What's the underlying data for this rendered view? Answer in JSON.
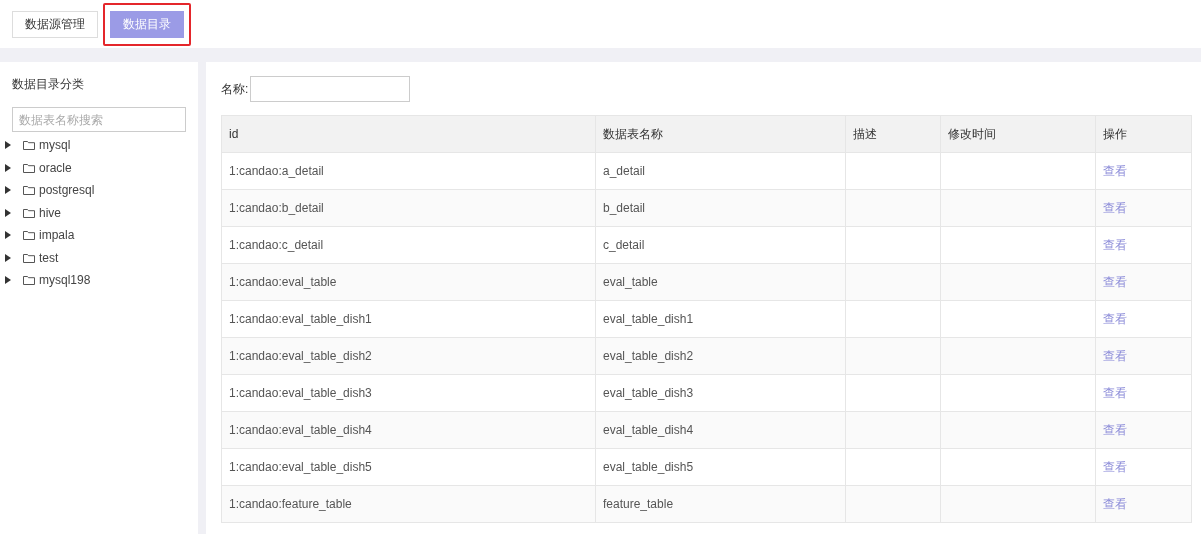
{
  "tabs": [
    {
      "label": "数据源管理",
      "selected": false,
      "highlighted": false
    },
    {
      "label": "数据目录",
      "selected": true,
      "highlighted": true
    }
  ],
  "sidebar": {
    "title": "数据目录分类",
    "search": {
      "placeholder": "数据表名称搜索"
    },
    "items": [
      {
        "label": "mysql",
        "expanded": false
      },
      {
        "label": "oracle",
        "expanded": false
      },
      {
        "label": "postgresql",
        "expanded": false
      },
      {
        "label": "hive",
        "expanded": false
      },
      {
        "label": "impala",
        "expanded": false
      },
      {
        "label": "test",
        "expanded": false
      },
      {
        "label": "mysql198",
        "expanded": false
      }
    ]
  },
  "filter": {
    "label": "名称:"
  },
  "table": {
    "columns": [
      "id",
      "数据表名称",
      "描述",
      "修改时间",
      "操作"
    ],
    "rows": [
      {
        "id": "1:candao:a_detail",
        "name": "a_detail",
        "action": "查看"
      },
      {
        "id": "1:candao:b_detail",
        "name": "b_detail",
        "action": "查看"
      },
      {
        "id": "1:candao:c_detail",
        "name": "c_detail",
        "action": "查看"
      },
      {
        "id": "1:candao:eval_table",
        "name": "eval_table",
        "action": "查看"
      },
      {
        "id": "1:candao:eval_table_dish1",
        "name": "eval_table_dish1",
        "action": "查看"
      },
      {
        "id": "1:candao:eval_table_dish2",
        "name": "eval_table_dish2",
        "action": "查看"
      },
      {
        "id": "1:candao:eval_table_dish3",
        "name": "eval_table_dish3",
        "action": "查看"
      },
      {
        "id": "1:candao:eval_table_dish4",
        "name": "eval_table_dish4",
        "action": "查看"
      },
      {
        "id": "1:candao:eval_table_dish5",
        "name": "eval_table_dish5",
        "action": "查看"
      },
      {
        "id": "1:candao:feature_table",
        "name": "feature_table",
        "action": "查看"
      }
    ]
  }
}
